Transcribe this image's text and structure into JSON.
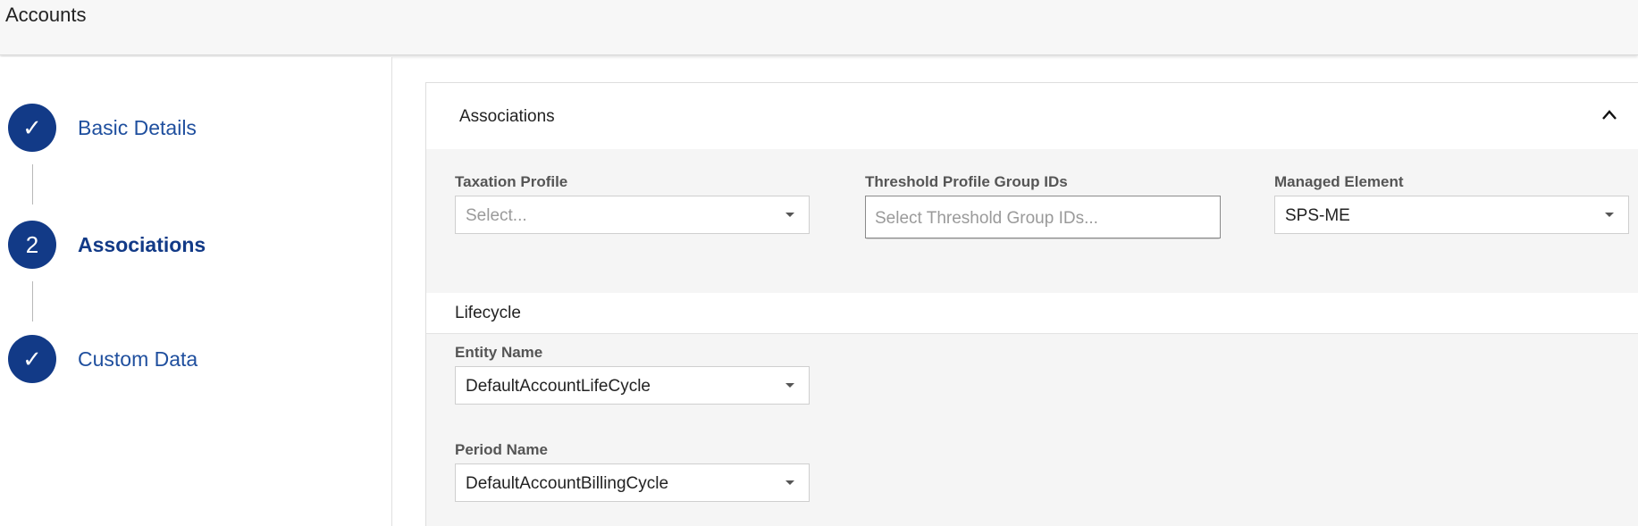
{
  "header": {
    "title": "Accounts"
  },
  "stepper": {
    "steps": [
      {
        "label": "Basic Details",
        "badge": "✓",
        "state": "completed"
      },
      {
        "label": "Associations",
        "badge": "2",
        "state": "active"
      },
      {
        "label": "Custom Data",
        "badge": "✓",
        "state": "completed"
      }
    ]
  },
  "associations": {
    "title": "Associations",
    "taxation_profile": {
      "label": "Taxation Profile",
      "placeholder": "Select..."
    },
    "threshold_groups": {
      "label": "Threshold Profile Group IDs",
      "placeholder": "Select Threshold Group IDs..."
    },
    "managed_element": {
      "label": "Managed Element",
      "value": "SPS-ME"
    }
  },
  "lifecycle": {
    "title": "Lifecycle",
    "entity_name": {
      "label": "Entity Name",
      "value": "DefaultAccountLifeCycle"
    },
    "period_name": {
      "label": "Period Name",
      "value": "DefaultAccountBillingCycle"
    }
  },
  "colors": {
    "accent": "#123a87",
    "link": "#1f4f9e",
    "panel_bg": "#f5f5f5"
  }
}
